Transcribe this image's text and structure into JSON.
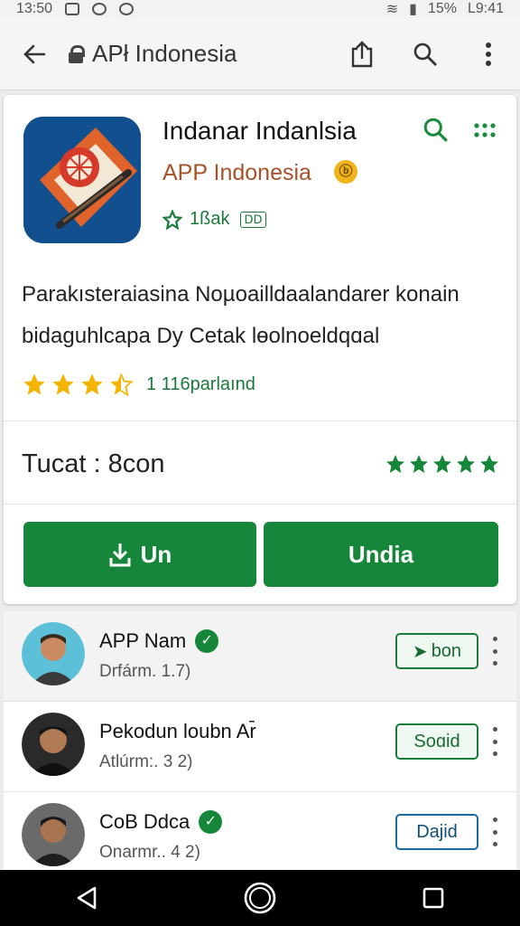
{
  "status_bar": {
    "time_left": "13:50",
    "battery": "15%",
    "time_right": "L9:41"
  },
  "app_bar": {
    "url": "APł Indonesia"
  },
  "app": {
    "name": "Indanar Indanlsia",
    "developer": "APP Indonesia",
    "developer_badge": "ⓑ",
    "sub_label": "1ßak",
    "sub_tag": "ⅮⅮ",
    "description": "Parakısteraiasina Noµoailldaalandarer konain bidaguhlcapa Dy Cetak lɵolnoeldqɑal",
    "rating_stars": 3.5,
    "rating_text": "1 116parlaınd",
    "total_label": "Tucat : 8con",
    "green_stars": 5,
    "buttons": {
      "primary": "Un",
      "secondary": "Undia"
    }
  },
  "list": [
    {
      "name": "APP Nam",
      "verified": true,
      "sub": "Drfárm. 1.7)",
      "action": "bon"
    },
    {
      "name": "Pekodun loubn Ar̄",
      "verified": false,
      "sub": "Atlúrm:. 3 2)",
      "action": "Soɑid"
    },
    {
      "name": "CoB Ddca",
      "verified": true,
      "sub": "Onarmr.. 4 2)",
      "action": "Dajid"
    }
  ],
  "colors": {
    "accent": "#16863a",
    "developer": "#a6522a",
    "star": "#f4b400"
  }
}
